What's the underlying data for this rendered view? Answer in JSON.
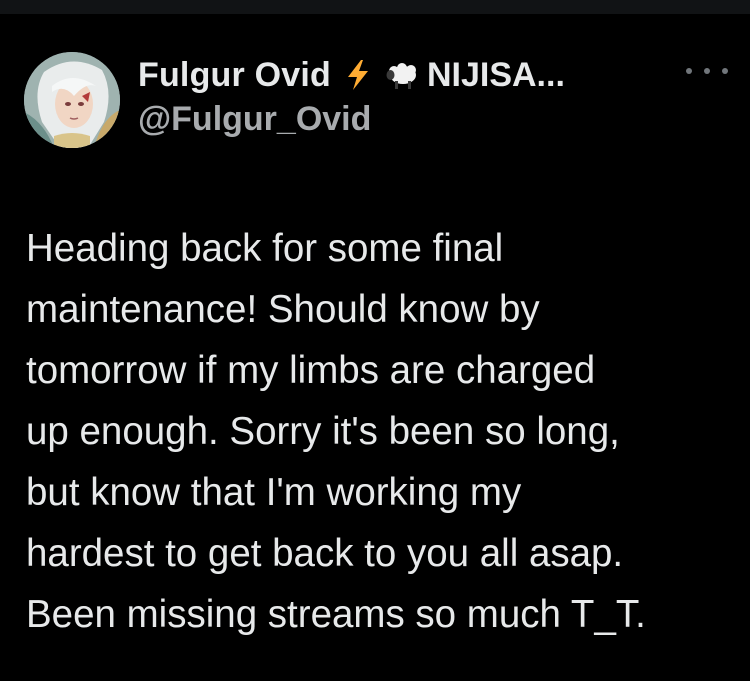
{
  "tweet": {
    "display_name": "Fulgur Ovid",
    "emojis": [
      "lightning-icon",
      "sheep-icon"
    ],
    "affiliation": "NIJISA...",
    "handle": "@Fulgur_Ovid",
    "body_lines": [
      "Heading back for some final",
      "maintenance! Should know by",
      "tomorrow if my limbs are charged",
      "up enough. Sorry it's been so long,",
      "but know that I'm working my",
      "hardest to get back to you all asap.",
      "Been missing streams so much T_T."
    ]
  },
  "colors": {
    "background": "#000000",
    "text": "#e7e9ea",
    "secondary": "#a8abae",
    "lightning": "#ffac33"
  }
}
